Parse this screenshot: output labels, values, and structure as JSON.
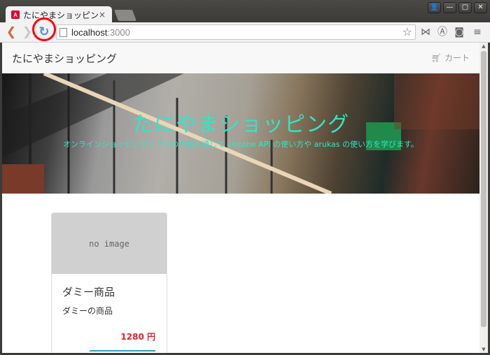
{
  "browser": {
    "tab_title": "たにやまショッピング",
    "tab_close": "×",
    "url_host": "localhost",
    "url_port": ":3000",
    "window_buttons": [
      "👤",
      "—",
      "▢",
      "✕"
    ]
  },
  "navbar": {
    "brand": "たにやまショッピング",
    "cart_label": "カート"
  },
  "hero": {
    "title": "たにやまショッピング",
    "subtitle": "オンラインショッピングアプリの作成を通じて kintone API の使い方や arukas の使い方を学びます。"
  },
  "products": [
    {
      "image_placeholder": "no image",
      "name": "ダミー商品",
      "description": "ダミーの商品",
      "price": "1280 円"
    }
  ],
  "icons": {
    "back": "arrow-left-icon",
    "forward": "arrow-right-icon",
    "reload": "reload-icon",
    "star": "star-icon",
    "cart": "cart-icon"
  },
  "colors": {
    "hero_text": "#2ee6c8",
    "price": "#d9262c",
    "annotation_circle": "#ff0000"
  }
}
